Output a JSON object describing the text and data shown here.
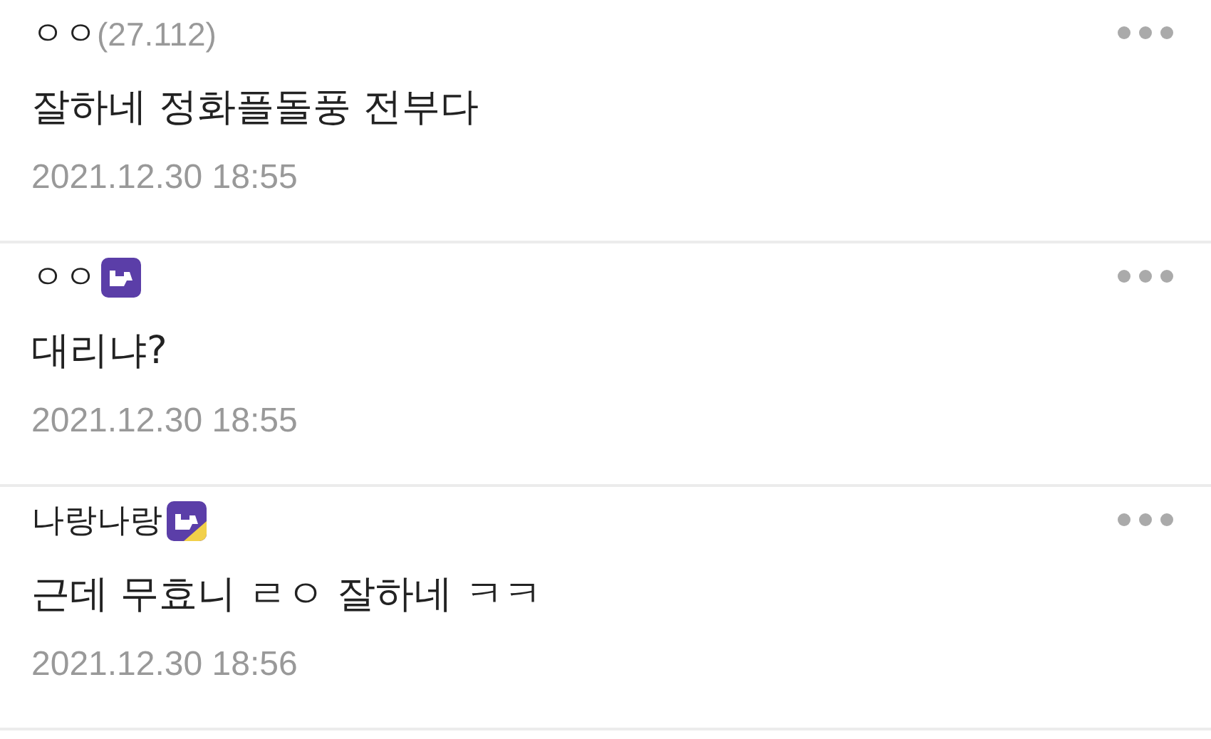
{
  "comments": [
    {
      "kind": "plain",
      "author": "ㅇㅇ",
      "ip": "(27.112)",
      "text": "잘하네 정화플돌풍 전부다",
      "date": "2021.12.30 18:55"
    },
    {
      "kind": "fixed",
      "author": "ㅇㅇ",
      "text": "대리냐?",
      "date": "2021.12.30 18:55"
    },
    {
      "kind": "half",
      "author": "나랑나랑",
      "text": "근데 무효니 ㄹㅇ 잘하네 ㅋㅋ",
      "date": "2021.12.30 18:56"
    }
  ]
}
